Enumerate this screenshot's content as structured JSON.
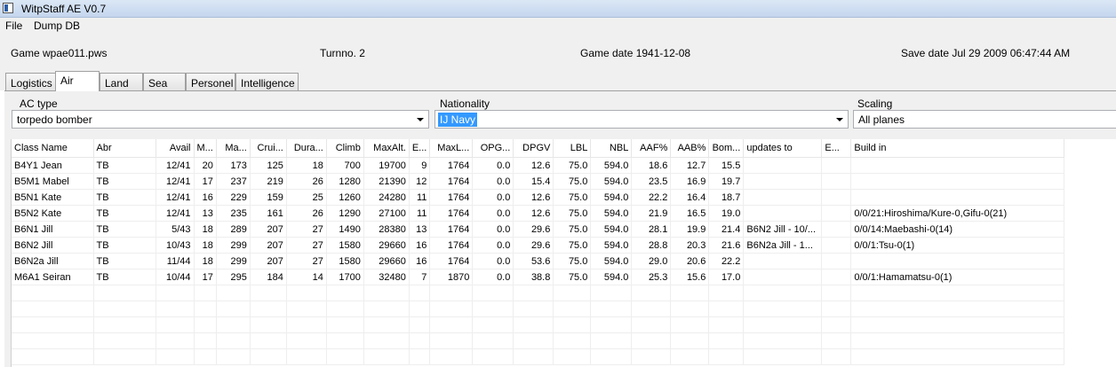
{
  "window": {
    "title": "WitpStaff AE V0.7"
  },
  "menu": [
    {
      "label": "File"
    },
    {
      "label": "Dump DB"
    }
  ],
  "info": {
    "game": "Game wpae011.pws",
    "turn": "Turnno. 2",
    "game_date": "Game date 1941-12-08",
    "save_date": "Save date Jul 29 2009  06:47:44 AM"
  },
  "tabs": [
    {
      "label": "Logistics",
      "active": false
    },
    {
      "label": "Air",
      "active": true
    },
    {
      "label": "Land",
      "active": false
    },
    {
      "label": "Sea",
      "active": false
    },
    {
      "label": "Personel",
      "active": false
    },
    {
      "label": "Intelligence",
      "active": false
    }
  ],
  "filters": {
    "ac_type": {
      "label": "AC type",
      "value": "torpedo bomber"
    },
    "nationality": {
      "label": "Nationality",
      "value": "IJ Navy"
    },
    "scaling": {
      "label": "Scaling",
      "value": "All planes"
    }
  },
  "table": {
    "columns": [
      "Class Name",
      "Abr",
      "Avail",
      "M...",
      "Ma...",
      "Crui...",
      "Dura...",
      "Climb",
      "MaxAlt.",
      "E...",
      "MaxL...",
      "OPG...",
      "DPGV",
      "LBL",
      "NBL",
      "AAF%",
      "AAB%",
      "Bom...",
      "updates to",
      "E...",
      "Build in"
    ],
    "rows": [
      [
        "B4Y1 Jean",
        "TB",
        "12/41",
        "20",
        "173",
        "125",
        "18",
        "700",
        "19700",
        "9",
        "1764",
        "0.0",
        "12.6",
        "75.0",
        "594.0",
        "18.6",
        "12.7",
        "15.5",
        "",
        "",
        ""
      ],
      [
        "B5M1 Mabel",
        "TB",
        "12/41",
        "17",
        "237",
        "219",
        "26",
        "1280",
        "21390",
        "12",
        "1764",
        "0.0",
        "15.4",
        "75.0",
        "594.0",
        "23.5",
        "16.9",
        "19.7",
        "",
        "",
        ""
      ],
      [
        "B5N1 Kate",
        "TB",
        "12/41",
        "16",
        "229",
        "159",
        "25",
        "1260",
        "24280",
        "11",
        "1764",
        "0.0",
        "12.6",
        "75.0",
        "594.0",
        "22.2",
        "16.4",
        "18.7",
        "",
        "",
        ""
      ],
      [
        "B5N2 Kate",
        "TB",
        "12/41",
        "13",
        "235",
        "161",
        "26",
        "1290",
        "27100",
        "11",
        "1764",
        "0.0",
        "12.6",
        "75.0",
        "594.0",
        "21.9",
        "16.5",
        "19.0",
        "",
        "",
        "0/0/21:Hiroshima/Kure-0,Gifu-0(21)"
      ],
      [
        "B6N1 Jill",
        "TB",
        "5/43",
        "18",
        "289",
        "207",
        "27",
        "1490",
        "28380",
        "13",
        "1764",
        "0.0",
        "29.6",
        "75.0",
        "594.0",
        "28.1",
        "19.9",
        "21.4",
        "B6N2 Jill - 10/...",
        "",
        "0/0/14:Maebashi-0(14)"
      ],
      [
        "B6N2 Jill",
        "TB",
        "10/43",
        "18",
        "299",
        "207",
        "27",
        "1580",
        "29660",
        "16",
        "1764",
        "0.0",
        "29.6",
        "75.0",
        "594.0",
        "28.8",
        "20.3",
        "21.6",
        "B6N2a Jill - 1...",
        "",
        "0/0/1:Tsu-0(1)"
      ],
      [
        "B6N2a Jill",
        "TB",
        "11/44",
        "18",
        "299",
        "207",
        "27",
        "1580",
        "29660",
        "16",
        "1764",
        "0.0",
        "53.6",
        "75.0",
        "594.0",
        "29.0",
        "20.6",
        "22.2",
        "",
        "",
        ""
      ],
      [
        "M6A1 Seiran",
        "TB",
        "10/44",
        "17",
        "295",
        "184",
        "14",
        "1700",
        "32480",
        "7",
        "1870",
        "0.0",
        "38.8",
        "75.0",
        "594.0",
        "25.3",
        "15.6",
        "17.0",
        "",
        "",
        "0/0/1:Hamamatsu-0(1)"
      ]
    ]
  }
}
